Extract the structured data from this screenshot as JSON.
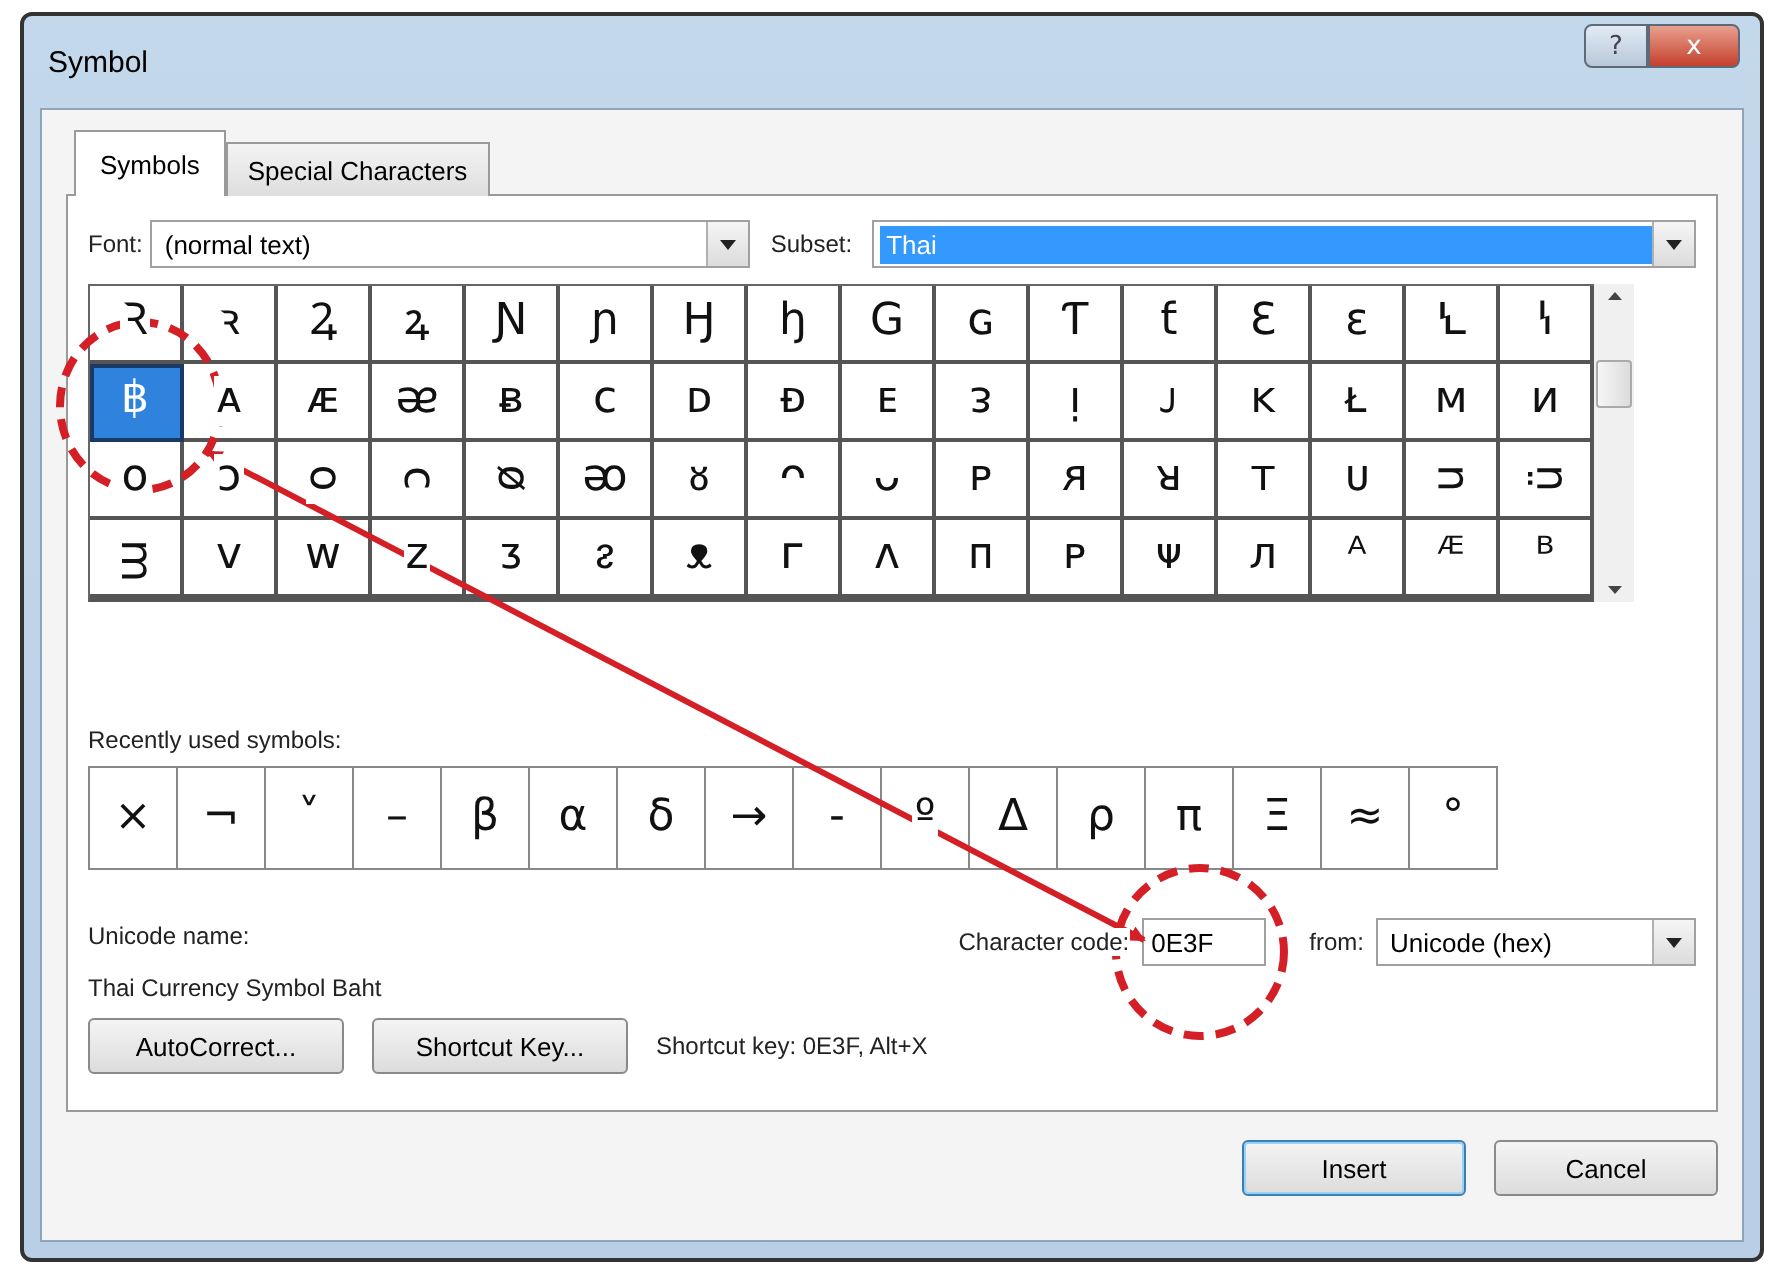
{
  "window": {
    "title": "Symbol",
    "help_button": "?",
    "close_button": "x"
  },
  "tabs": [
    {
      "label": "Symbols",
      "selected": true
    },
    {
      "label": "Special Characters",
      "selected": false
    }
  ],
  "font": {
    "label": "Font:",
    "value": "(normal text)"
  },
  "subset": {
    "label": "Subset:",
    "value": "Thai",
    "highlighted": true
  },
  "symbols": [
    {
      "char": "Ꝛ",
      "selected": false
    },
    {
      "char": "ꝛ",
      "selected": false
    },
    {
      "char": "Ꝝ",
      "selected": false
    },
    {
      "char": "ꝝ",
      "selected": false
    },
    {
      "char": "Ɲ",
      "selected": false
    },
    {
      "char": "ɲ",
      "selected": false
    },
    {
      "char": "Ꜧ",
      "selected": false
    },
    {
      "char": "ꜧ",
      "selected": false
    },
    {
      "char": "G",
      "selected": false
    },
    {
      "char": "ɢ",
      "selected": false
    },
    {
      "char": "Ƭ",
      "selected": false
    },
    {
      "char": "ƭ",
      "selected": false
    },
    {
      "char": "Ɛ",
      "selected": false
    },
    {
      "char": "ɛ",
      "selected": false
    },
    {
      "char": "Ꝇ",
      "selected": false
    },
    {
      "char": "ꝇ",
      "selected": false
    },
    {
      "char": "฿",
      "selected": true
    },
    {
      "char": "ᴀ",
      "selected": false
    },
    {
      "char": "ᴁ",
      "selected": false
    },
    {
      "char": "ᴂ",
      "selected": false
    },
    {
      "char": "ᴃ",
      "selected": false
    },
    {
      "char": "ᴄ",
      "selected": false
    },
    {
      "char": "ᴅ",
      "selected": false
    },
    {
      "char": "ᴆ",
      "selected": false
    },
    {
      "char": "ᴇ",
      "selected": false
    },
    {
      "char": "ᴈ",
      "selected": false
    },
    {
      "char": "ᴉ",
      "selected": false
    },
    {
      "char": "ᴊ",
      "selected": false
    },
    {
      "char": "ᴋ",
      "selected": false
    },
    {
      "char": "ᴌ",
      "selected": false
    },
    {
      "char": "ᴍ",
      "selected": false
    },
    {
      "char": "ᴎ",
      "selected": false
    },
    {
      "char": "ᴏ",
      "selected": false
    },
    {
      "char": "ᴐ",
      "selected": false
    },
    {
      "char": "ᴑ",
      "selected": false
    },
    {
      "char": "ᴒ",
      "selected": false
    },
    {
      "char": "ᴓ",
      "selected": false
    },
    {
      "char": "ᴔ",
      "selected": false
    },
    {
      "char": "ᴕ",
      "selected": false
    },
    {
      "char": "ᴖ",
      "selected": false
    },
    {
      "char": "ᴗ",
      "selected": false
    },
    {
      "char": "ᴘ",
      "selected": false
    },
    {
      "char": "ᴙ",
      "selected": false
    },
    {
      "char": "ᴚ",
      "selected": false
    },
    {
      "char": "ᴛ",
      "selected": false
    },
    {
      "char": "ᴜ",
      "selected": false
    },
    {
      "char": "ᴝ",
      "selected": false
    },
    {
      "char": "ᴞ",
      "selected": false
    },
    {
      "char": "ᴟ",
      "selected": false
    },
    {
      "char": "ᴠ",
      "selected": false
    },
    {
      "char": "ᴡ",
      "selected": false
    },
    {
      "char": "ᴢ",
      "selected": false
    },
    {
      "char": "ᴣ",
      "selected": false
    },
    {
      "char": "ᴤ",
      "selected": false
    },
    {
      "char": "ᴥ",
      "selected": false
    },
    {
      "char": "ᴦ",
      "selected": false
    },
    {
      "char": "ᴧ",
      "selected": false
    },
    {
      "char": "ᴨ",
      "selected": false
    },
    {
      "char": "ᴩ",
      "selected": false
    },
    {
      "char": "ᴪ",
      "selected": false
    },
    {
      "char": "ᴫ",
      "selected": false
    },
    {
      "char": "ᴬ",
      "selected": false
    },
    {
      "char": "ᴭ",
      "selected": false
    },
    {
      "char": "ᴮ",
      "selected": false
    }
  ],
  "recent_label": "Recently used symbols:",
  "recent_symbols": [
    "×",
    "¬",
    "˅",
    "–",
    "β",
    "α",
    "δ",
    "→",
    "-",
    "º",
    "Δ",
    "ρ",
    "π",
    "Ξ",
    "≈",
    "°"
  ],
  "unicode_name_label": "Unicode name:",
  "unicode_name": "Thai Currency Symbol Baht",
  "character_code": {
    "label": "Character code:",
    "value": "0E3F"
  },
  "from": {
    "label": "from:",
    "value": "Unicode (hex)"
  },
  "autocorrect_button": "AutoCorrect...",
  "shortcut_key_button": "Shortcut Key...",
  "shortcut_key_text": "Shortcut key: 0E3F, Alt+X",
  "insert_button": "Insert",
  "cancel_button": "Cancel"
}
